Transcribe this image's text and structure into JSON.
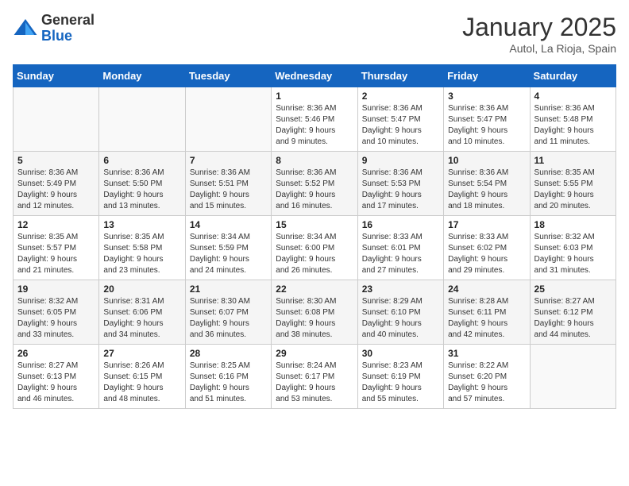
{
  "header": {
    "logo_general": "General",
    "logo_blue": "Blue",
    "month": "January 2025",
    "location": "Autol, La Rioja, Spain"
  },
  "weekdays": [
    "Sunday",
    "Monday",
    "Tuesday",
    "Wednesday",
    "Thursday",
    "Friday",
    "Saturday"
  ],
  "weeks": [
    [
      {
        "day": "",
        "info": ""
      },
      {
        "day": "",
        "info": ""
      },
      {
        "day": "",
        "info": ""
      },
      {
        "day": "1",
        "info": "Sunrise: 8:36 AM\nSunset: 5:46 PM\nDaylight: 9 hours\nand 9 minutes."
      },
      {
        "day": "2",
        "info": "Sunrise: 8:36 AM\nSunset: 5:47 PM\nDaylight: 9 hours\nand 10 minutes."
      },
      {
        "day": "3",
        "info": "Sunrise: 8:36 AM\nSunset: 5:47 PM\nDaylight: 9 hours\nand 10 minutes."
      },
      {
        "day": "4",
        "info": "Sunrise: 8:36 AM\nSunset: 5:48 PM\nDaylight: 9 hours\nand 11 minutes."
      }
    ],
    [
      {
        "day": "5",
        "info": "Sunrise: 8:36 AM\nSunset: 5:49 PM\nDaylight: 9 hours\nand 12 minutes."
      },
      {
        "day": "6",
        "info": "Sunrise: 8:36 AM\nSunset: 5:50 PM\nDaylight: 9 hours\nand 13 minutes."
      },
      {
        "day": "7",
        "info": "Sunrise: 8:36 AM\nSunset: 5:51 PM\nDaylight: 9 hours\nand 15 minutes."
      },
      {
        "day": "8",
        "info": "Sunrise: 8:36 AM\nSunset: 5:52 PM\nDaylight: 9 hours\nand 16 minutes."
      },
      {
        "day": "9",
        "info": "Sunrise: 8:36 AM\nSunset: 5:53 PM\nDaylight: 9 hours\nand 17 minutes."
      },
      {
        "day": "10",
        "info": "Sunrise: 8:36 AM\nSunset: 5:54 PM\nDaylight: 9 hours\nand 18 minutes."
      },
      {
        "day": "11",
        "info": "Sunrise: 8:35 AM\nSunset: 5:55 PM\nDaylight: 9 hours\nand 20 minutes."
      }
    ],
    [
      {
        "day": "12",
        "info": "Sunrise: 8:35 AM\nSunset: 5:57 PM\nDaylight: 9 hours\nand 21 minutes."
      },
      {
        "day": "13",
        "info": "Sunrise: 8:35 AM\nSunset: 5:58 PM\nDaylight: 9 hours\nand 23 minutes."
      },
      {
        "day": "14",
        "info": "Sunrise: 8:34 AM\nSunset: 5:59 PM\nDaylight: 9 hours\nand 24 minutes."
      },
      {
        "day": "15",
        "info": "Sunrise: 8:34 AM\nSunset: 6:00 PM\nDaylight: 9 hours\nand 26 minutes."
      },
      {
        "day": "16",
        "info": "Sunrise: 8:33 AM\nSunset: 6:01 PM\nDaylight: 9 hours\nand 27 minutes."
      },
      {
        "day": "17",
        "info": "Sunrise: 8:33 AM\nSunset: 6:02 PM\nDaylight: 9 hours\nand 29 minutes."
      },
      {
        "day": "18",
        "info": "Sunrise: 8:32 AM\nSunset: 6:03 PM\nDaylight: 9 hours\nand 31 minutes."
      }
    ],
    [
      {
        "day": "19",
        "info": "Sunrise: 8:32 AM\nSunset: 6:05 PM\nDaylight: 9 hours\nand 33 minutes."
      },
      {
        "day": "20",
        "info": "Sunrise: 8:31 AM\nSunset: 6:06 PM\nDaylight: 9 hours\nand 34 minutes."
      },
      {
        "day": "21",
        "info": "Sunrise: 8:30 AM\nSunset: 6:07 PM\nDaylight: 9 hours\nand 36 minutes."
      },
      {
        "day": "22",
        "info": "Sunrise: 8:30 AM\nSunset: 6:08 PM\nDaylight: 9 hours\nand 38 minutes."
      },
      {
        "day": "23",
        "info": "Sunrise: 8:29 AM\nSunset: 6:10 PM\nDaylight: 9 hours\nand 40 minutes."
      },
      {
        "day": "24",
        "info": "Sunrise: 8:28 AM\nSunset: 6:11 PM\nDaylight: 9 hours\nand 42 minutes."
      },
      {
        "day": "25",
        "info": "Sunrise: 8:27 AM\nSunset: 6:12 PM\nDaylight: 9 hours\nand 44 minutes."
      }
    ],
    [
      {
        "day": "26",
        "info": "Sunrise: 8:27 AM\nSunset: 6:13 PM\nDaylight: 9 hours\nand 46 minutes."
      },
      {
        "day": "27",
        "info": "Sunrise: 8:26 AM\nSunset: 6:15 PM\nDaylight: 9 hours\nand 48 minutes."
      },
      {
        "day": "28",
        "info": "Sunrise: 8:25 AM\nSunset: 6:16 PM\nDaylight: 9 hours\nand 51 minutes."
      },
      {
        "day": "29",
        "info": "Sunrise: 8:24 AM\nSunset: 6:17 PM\nDaylight: 9 hours\nand 53 minutes."
      },
      {
        "day": "30",
        "info": "Sunrise: 8:23 AM\nSunset: 6:19 PM\nDaylight: 9 hours\nand 55 minutes."
      },
      {
        "day": "31",
        "info": "Sunrise: 8:22 AM\nSunset: 6:20 PM\nDaylight: 9 hours\nand 57 minutes."
      },
      {
        "day": "",
        "info": ""
      }
    ]
  ]
}
